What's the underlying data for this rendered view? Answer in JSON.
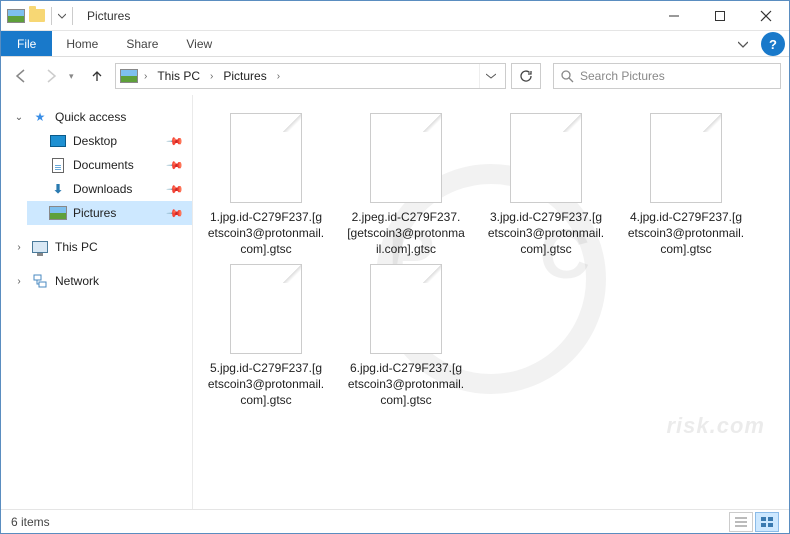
{
  "window": {
    "title": "Pictures"
  },
  "ribbon": {
    "file": "File",
    "tabs": [
      "Home",
      "Share",
      "View"
    ]
  },
  "breadcrumb": {
    "root": "This PC",
    "folder": "Pictures"
  },
  "search": {
    "placeholder": "Search Pictures"
  },
  "sidebar": {
    "quick": "Quick access",
    "items": [
      {
        "label": "Desktop",
        "pinned": true
      },
      {
        "label": "Documents",
        "pinned": true
      },
      {
        "label": "Downloads",
        "pinned": true
      },
      {
        "label": "Pictures",
        "pinned": true,
        "selected": true
      }
    ],
    "thispc": "This PC",
    "network": "Network"
  },
  "files": [
    {
      "name": "1.jpg.id-C279F237.[getscoin3@protonmail.com].gtsc"
    },
    {
      "name": "2.jpeg.id-C279F237.[getscoin3@protonmail.com].gtsc"
    },
    {
      "name": "3.jpg.id-C279F237.[getscoin3@protonmail.com].gtsc"
    },
    {
      "name": "4.jpg.id-C279F237.[getscoin3@protonmail.com].gtsc"
    },
    {
      "name": "5.jpg.id-C279F237.[getscoin3@protonmail.com].gtsc"
    },
    {
      "name": "6.jpg.id-C279F237.[getscoin3@protonmail.com].gtsc"
    }
  ],
  "status": {
    "count": "6 items"
  },
  "watermark": {
    "sub": "risk.com"
  }
}
